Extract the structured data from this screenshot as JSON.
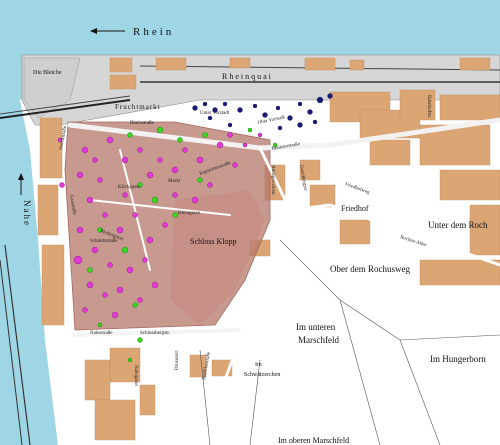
{
  "map": {
    "labels": {
      "rhein": "Rhein",
      "nahe": "Nahe",
      "die_bleiche": "Die Bleiche",
      "rheinquai": "Rheinquai",
      "fruchtmarkt": "Fruchtmarkt",
      "unter_vorstadt": "Unter Vorstadt",
      "ober_vorstadt": "Ober Vorstadt",
      "mainzerstrasse": "Mainzerstraße",
      "friedhof": "Friedhof",
      "friedhofweg": "Friedhofweg",
      "unter_dem_roch": "Unter dem Roch",
      "rochus_allee": "Rochus-Allee",
      "ober_dem_rochusweg": "Ober dem Rochusweg",
      "schloss_klopp": "Schloss Klopp",
      "im_unteren_marschfeld": "Im unteren Marschfeld",
      "im_hungerborn": "Im Hungerborn",
      "im_schwaetzerchen": "Im Schwätzerchen",
      "im_oberen_marschfeld": "Im oberen Marschfeld",
      "nahestrasse": "Nahestraße",
      "schlossbergstr": "Schlossbergstr.",
      "drususstr": "Drususstr.",
      "basilikastrasse": "Basilikastraße",
      "rheinstrasse": "Rheinstraße",
      "kirchgasse": "Kirchgasse",
      "markt": "Markt",
      "kapuzinerstrasse": "Kapuzinerstraße",
      "kleingasse": "Kleingasse",
      "pfeffergasse": "Pfeffergasse",
      "gaustrasse": "Gaustraße",
      "schmittstrasse": "Schmittstraße",
      "hafenstrasse": "Hafenstraße",
      "bahnhofstr": "Bahnhofstr.",
      "amtsgerichtstr": "Amtsgerichtstr.",
      "gutenbergstr": "Gutenbergstr.",
      "nahegasse": "Nahegasse"
    },
    "colors": {
      "river": "#9fd6e6",
      "building": "#dca574",
      "old_town": "#b5776a",
      "quay": "#d8d8d8",
      "dot_magenta": "#e23ad8",
      "dot_green": "#39d81e",
      "dot_navy": "#1a1a7a"
    },
    "arrows": [
      "arrow-left-icon",
      "arrow-up-icon"
    ]
  }
}
